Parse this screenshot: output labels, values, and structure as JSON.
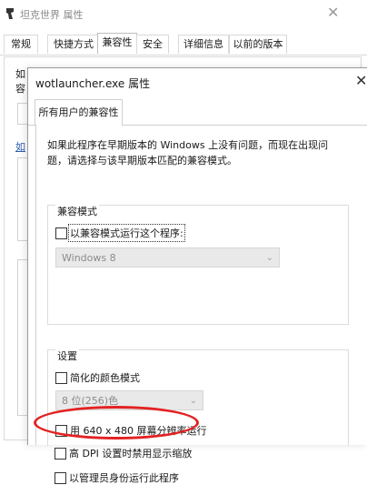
{
  "parent_window": {
    "title": "坦克世界 属性",
    "close_glyph": "✕",
    "tabs": [
      {
        "label": "常规"
      },
      {
        "label": "快捷方式"
      },
      {
        "label": "兼容性"
      },
      {
        "label": "安全"
      },
      {
        "label": "详细信息"
      },
      {
        "label": "以前的版本"
      }
    ],
    "active_tab": "兼容性",
    "fragment_1": "如",
    "fragment_2": "容",
    "fragment_link": "如"
  },
  "dialog": {
    "title": "wotlauncher.exe 属性",
    "close_glyph": "✕",
    "tab_label": "所有用户的兼容性",
    "description": "如果此程序在早期版本的 Windows 上没有问题，而现在出现问题，请选择与该早期版本匹配的兼容模式。",
    "compat_mode": {
      "group_label": "兼容模式",
      "checkbox_label": "以兼容模式运行这个程序:",
      "checked": false,
      "select_value": "Windows 8"
    },
    "settings": {
      "group_label": "设置",
      "reduced_color": {
        "label": "简化的颜色模式",
        "checked": false
      },
      "color_select_value": "8 位(256)色",
      "res_640": {
        "label": "用 640 x 480 屏幕分辨率运行",
        "checked": false
      },
      "high_dpi": {
        "label": "高 DPI 设置时禁用显示缩放",
        "checked": false
      },
      "run_admin": {
        "label": "以管理员身份运行此程序",
        "checked": false
      }
    }
  },
  "colors": {
    "highlight_ellipse": "#e32222",
    "link": "#2a5db0"
  },
  "icons": {
    "parent_window_icon": "tank-app-icon",
    "dropdown_caret": "chevron-down-icon"
  }
}
